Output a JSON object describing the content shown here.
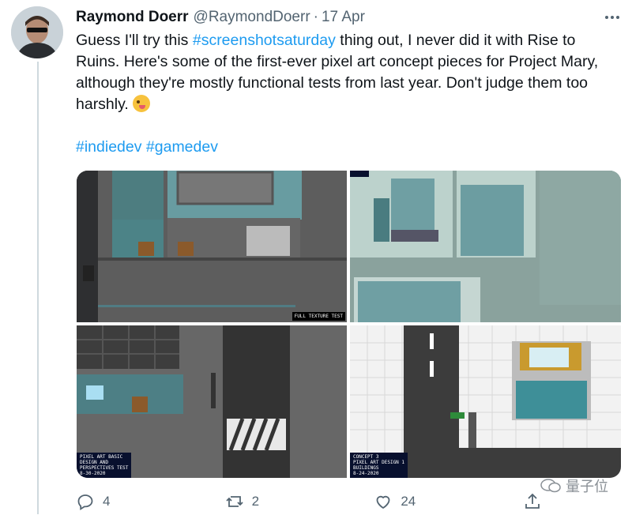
{
  "tweet": {
    "author_name": "Raymond Doerr",
    "handle": "@RaymondDoerr",
    "separator": "·",
    "date": "17 Apr",
    "text_parts": [
      "Guess I'll try this ",
      "#screenshotsaturday",
      " thing out, I never did it with Rise to Ruins. Here's some of the first-ever pixel art concept pieces for Project Mary, although they're mostly functional tests from last year. Don't judge them too harshly. "
    ],
    "emoji": "face-with-tongue-emoji",
    "hashtags": [
      "#indiedev",
      "#gamedev"
    ]
  },
  "media": {
    "label_full_texture": "FULL TEXTURE TEST",
    "caption_basic": "PIXEL ART BASIC\nDESIGN AND\nPERSPECTIVES TEST\n8-30-2020",
    "caption_concept": "CONCEPT 3\nPIXEL ART DESIGN 1\nBUILDINGS\n8-24-2020"
  },
  "actions": {
    "reply_count": "4",
    "retweet_count": "2",
    "like_count": "24",
    "icons": [
      "reply-icon",
      "retweet-icon",
      "like-icon",
      "share-icon"
    ]
  },
  "watermark": "量子位",
  "colors": {
    "link": "#1d9bf0",
    "muted": "#536471",
    "text": "#0f1419"
  }
}
